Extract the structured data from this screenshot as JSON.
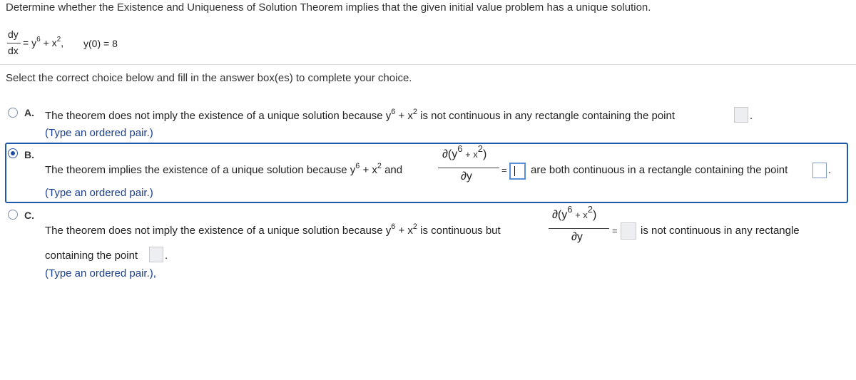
{
  "question": {
    "prompt": "Determine whether the Existence and Uniqueness of Solution Theorem implies that the given initial value problem has a unique solution.",
    "ode_num": "dy",
    "ode_den": "dx",
    "ode_eq": "=",
    "ode_y": "y",
    "ode_y_exp": "6",
    "ode_plus": "+",
    "ode_x": "x",
    "ode_x_exp": "2",
    "ode_comma": ",",
    "initial": "y(0) = 8"
  },
  "instruction": "Select the correct choice below and fill in the answer box(es) to complete your choice.",
  "selected": "B",
  "options": {
    "a": {
      "letter": "A.",
      "text1": "The theorem does not imply the existence of a unique solution because y",
      "exp1": "6",
      "text2": " + x",
      "exp2": "2",
      "text3": " is not continuous in any rectangle containing the point",
      "period": ".",
      "hint": "(Type an ordered pair.)"
    },
    "b": {
      "letter": "B.",
      "text1": "The theorem implies the existence of a unique solution because y",
      "exp1": "6",
      "text2": " + x",
      "exp2": "2",
      "text3": " and",
      "pd_num": "∂(y",
      "pd_num_exp1": "6",
      "pd_num_mid": " + x",
      "pd_num_exp2": "2",
      "pd_num_close": ")",
      "pd_den": "∂y",
      "eq": "=",
      "text4": "are both continuous in a rectangle containing the point",
      "period": ".",
      "hint": "(Type an ordered pair.)"
    },
    "c": {
      "letter": "C.",
      "text1": "The theorem does not imply the existence of a unique solution because y",
      "exp1": "6",
      "text2": " + x",
      "exp2": "2",
      "text3": " is continuous but",
      "pd_num": "∂(y",
      "pd_num_exp1": "6",
      "pd_num_mid": " + x",
      "pd_num_exp2": "2",
      "pd_num_close": ")",
      "pd_den": "∂y",
      "eq": "=",
      "text4": "is not continuous in any rectangle",
      "line2": "containing the point",
      "period": ".",
      "hint": "(Type an ordered pair.),"
    }
  }
}
